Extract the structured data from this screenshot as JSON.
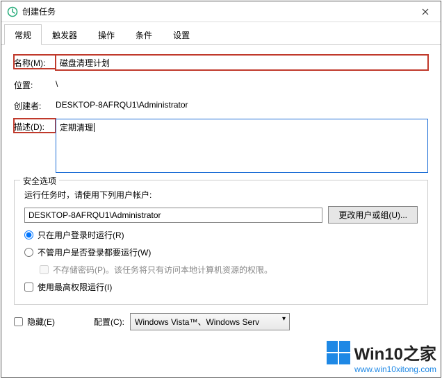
{
  "window": {
    "title": "创建任务"
  },
  "tabs": [
    "常规",
    "触发器",
    "操作",
    "条件",
    "设置"
  ],
  "activeTab": 0,
  "general": {
    "nameLabel": "名称(M):",
    "nameValue": "磁盘清理计划",
    "locationLabel": "位置:",
    "locationValue": "\\",
    "creatorLabel": "创建者:",
    "creatorValue": "DESKTOP-8AFRQU1\\Administrator",
    "descLabel": "描述(D):",
    "descValue": "定期清理"
  },
  "security": {
    "legend": "安全选项",
    "runAsLabel": "运行任务时，请使用下列用户帐户:",
    "account": "DESKTOP-8AFRQU1\\Administrator",
    "changeUserBtn": "更改用户或组(U)...",
    "radioLoggedOn": "只在用户登录时运行(R)",
    "radioAnyTime": "不管用户是否登录都要运行(W)",
    "noStorePwd": "不存储密码(P)。该任务将只有访问本地计算机资源的权限。",
    "highestPriv": "使用最高权限运行(I)"
  },
  "bottom": {
    "hidden": "隐藏(E)",
    "configureForLabel": "配置(C):",
    "configureForValue": "Windows Vista™、Windows Serv"
  },
  "watermark": {
    "brand": "Win10之家",
    "url": "www.win10xitong.com"
  }
}
